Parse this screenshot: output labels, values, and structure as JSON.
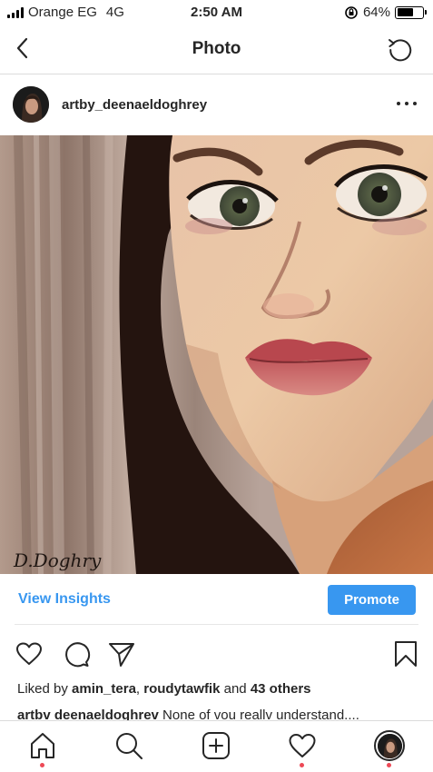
{
  "status_bar": {
    "carrier": "Orange EG",
    "network": "4G",
    "time": "2:50 AM",
    "battery": "64%",
    "battery_level": 0.64
  },
  "nav": {
    "title": "Photo",
    "back_icon": "chevron-left-icon",
    "refresh_icon": "refresh-icon"
  },
  "post": {
    "username": "artby_deenaeldoghrey",
    "image_description_icon": "painting",
    "signature": "D.Doghry"
  },
  "insights": {
    "view_insights": "View Insights",
    "promote": "Promote"
  },
  "likes": {
    "prefix": "Liked by ",
    "user1": "amin_tera",
    "sep": ", ",
    "user2": "roudytawfik",
    "and": " and ",
    "others": "43 others"
  },
  "caption": {
    "username": "artbv deenaeldoghrev",
    "text": " None of vou reallv understand...."
  },
  "colors": {
    "accent": "#3897f0",
    "notification": "#ed4956"
  }
}
